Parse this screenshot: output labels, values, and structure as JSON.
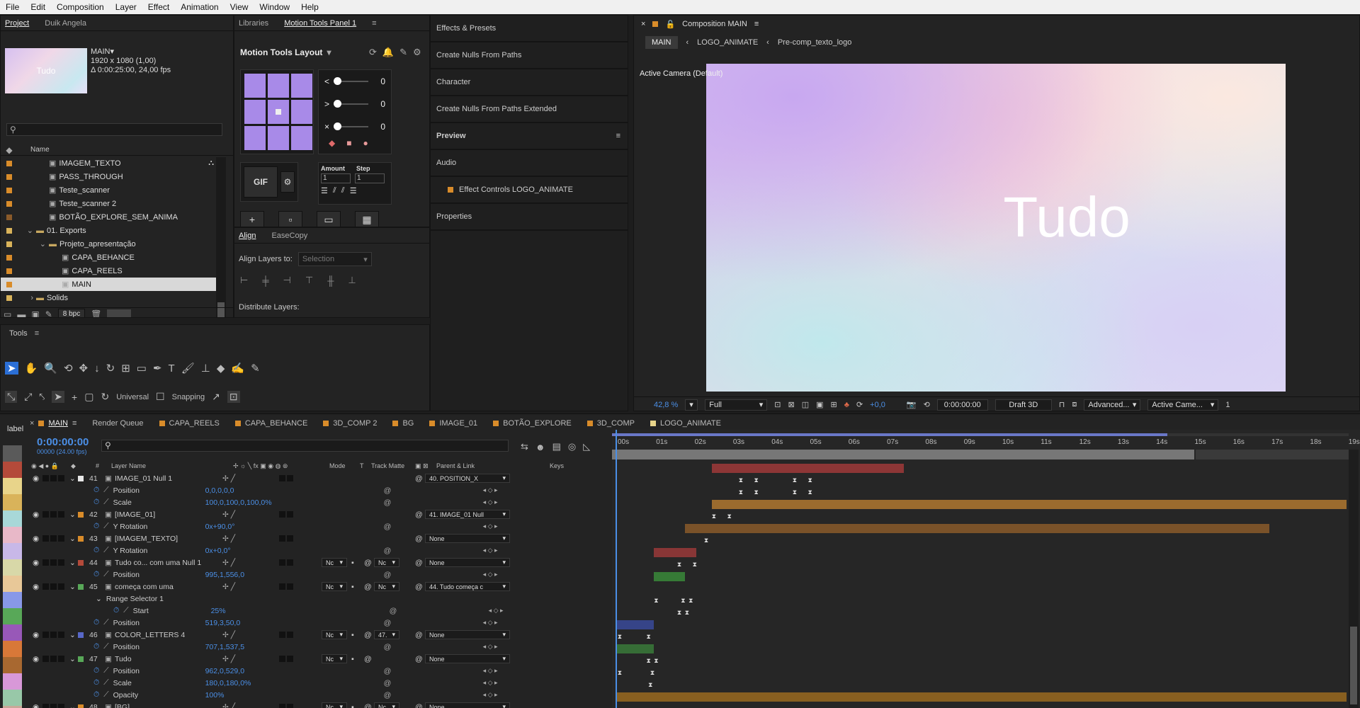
{
  "menu": [
    "File",
    "Edit",
    "Composition",
    "Layer",
    "Effect",
    "Animation",
    "View",
    "Window",
    "Help"
  ],
  "project": {
    "tabs": [
      "Project",
      "Duik Angela"
    ],
    "comp_name": "MAIN▾",
    "comp_info1": "1920 x 1080 (1,00)",
    "comp_info2": "Δ 0:00:25:00, 24,00 fps",
    "thumb_text": "Tudo",
    "search_placeholder": "",
    "col_name": "Name",
    "items": [
      {
        "name": "IMAGEM_TEXTO",
        "color": "#d98c2a",
        "indent": 1,
        "type": "comp"
      },
      {
        "name": "PASS_THROUGH",
        "color": "#d98c2a",
        "indent": 1,
        "type": "comp"
      },
      {
        "name": "Teste_scanner",
        "color": "#d98c2a",
        "indent": 1,
        "type": "comp"
      },
      {
        "name": "Teste_scanner 2",
        "color": "#d98c2a",
        "indent": 1,
        "type": "comp"
      },
      {
        "name": "BOTÃO_EXPLORE_SEM_ANIMA",
        "color": "#8a5a2a",
        "indent": 1,
        "type": "comp"
      },
      {
        "name": "01. Exports",
        "color": "#d9b35a",
        "indent": 0,
        "type": "folder",
        "open": true
      },
      {
        "name": "Projeto_apresentação",
        "color": "#d9b35a",
        "indent": 1,
        "type": "folder",
        "open": true
      },
      {
        "name": "CAPA_BEHANCE",
        "color": "#d98c2a",
        "indent": 2,
        "type": "comp"
      },
      {
        "name": "CAPA_REELS",
        "color": "#d98c2a",
        "indent": 2,
        "type": "comp"
      },
      {
        "name": "MAIN",
        "color": "#d98c2a",
        "indent": 2,
        "type": "comp",
        "selected": true
      },
      {
        "name": "Solids",
        "color": "#d9b35a",
        "indent": 0,
        "type": "folder",
        "open": false
      }
    ],
    "bpc": "8 bpc"
  },
  "motion_tools": {
    "tabs": [
      "Libraries",
      "Motion Tools Panel 1"
    ],
    "layout_title": "Motion Tools Layout",
    "sliders": [
      {
        "icon": "<",
        "value": "0"
      },
      {
        "icon": ">",
        "value": "0"
      },
      {
        "icon": "×",
        "value": "0"
      }
    ],
    "gif": "GIF",
    "amount_label": "Amount",
    "step_label": "Step",
    "amount": "1",
    "step": "1"
  },
  "align": {
    "tabs": [
      "Align",
      "EaseCopy"
    ],
    "align_to_label": "Align Layers to:",
    "align_to_value": "Selection",
    "distribute_label": "Distribute Layers:"
  },
  "effects": {
    "items": [
      "Effects & Presets",
      "Create Nulls From Paths",
      "Character",
      "Create Nulls From Paths Extended",
      "Preview",
      "Audio",
      "Effect Controls LOGO_ANIMATE",
      "Properties"
    ]
  },
  "tools": {
    "title": "Tools",
    "universal": "Universal",
    "snapping": "Snapping"
  },
  "composition": {
    "title": "Composition MAIN",
    "breadcrumbs": [
      "MAIN",
      "LOGO_ANIMATE",
      "Pre-comp_texto_logo"
    ],
    "camera_label": "Active Camera (Default)",
    "canvas_text": "Tudo",
    "zoom": "42,8 %",
    "resolution": "Full",
    "exposure": "+0,0",
    "timecode": "0:00:00:00",
    "renderer": "Draft 3D",
    "advanced": "Advanced...",
    "camera": "Active Came...",
    "views": "1"
  },
  "timeline": {
    "tabs": [
      {
        "name": "MAIN",
        "color": "#d98c2a",
        "active": true
      },
      {
        "name": "Render Queue",
        "color": ""
      },
      {
        "name": "CAPA_REELS",
        "color": "#d98c2a"
      },
      {
        "name": "CAPA_BEHANCE",
        "color": "#d98c2a"
      },
      {
        "name": "3D_COMP 2",
        "color": "#d98c2a"
      },
      {
        "name": "BG",
        "color": "#d98c2a"
      },
      {
        "name": "IMAGE_01",
        "color": "#d98c2a"
      },
      {
        "name": "BOTÃO_EXPLORE",
        "color": "#d98c2a"
      },
      {
        "name": "3D_COMP",
        "color": "#d98c2a"
      },
      {
        "name": "LOGO_ANIMATE",
        "color": "#e8d48a"
      }
    ],
    "timecode": "0:00:00:00",
    "timecode_sub": "00000 (24.00 fps)",
    "headers": {
      "layer_name": "Layer Name",
      "mode": "Mode",
      "t": "T",
      "track_matte": "Track Matte",
      "parent": "Parent & Link",
      "keys": "Keys",
      "label": "label"
    },
    "ruler": [
      "00s",
      "01s",
      "02s",
      "03s",
      "04s",
      "05s",
      "06s",
      "07s",
      "08s",
      "09s",
      "10s",
      "11s",
      "12s",
      "13s",
      "14s",
      "15s",
      "16s",
      "17s",
      "18s",
      "19s"
    ],
    "label_colors": [
      "#5a5a5a",
      "#b44a3a",
      "#e8d48a",
      "#d9b35a",
      "#a8d8d8",
      "#e8b8c8",
      "#c8b8e8",
      "#d8d8a8",
      "#e8c898",
      "#8898e8",
      "#58a858",
      "#9858b8",
      "#d87838",
      "#a86830",
      "#d898d8",
      "#98c8a8",
      "#c8a898",
      "#58a858"
    ],
    "rows": [
      {
        "num": "41",
        "name": "IMAGE_01 Null 1",
        "kind": "layer",
        "color": "#e8e8e8",
        "parent": "40. POSITION_X",
        "value": ""
      },
      {
        "num": "",
        "name": "Position",
        "kind": "prop",
        "value": "0,0,0,0,0"
      },
      {
        "num": "",
        "name": "Scale",
        "kind": "prop",
        "value": "100,0,100,0,100,0%"
      },
      {
        "num": "42",
        "name": "[IMAGE_01]",
        "kind": "layer",
        "color": "#d98c2a",
        "parent": "41. IMAGE_01 Null",
        "value": ""
      },
      {
        "num": "",
        "name": "Y Rotation",
        "kind": "prop",
        "value": "0x+90,0°"
      },
      {
        "num": "43",
        "name": "[IMAGEM_TEXTO]",
        "kind": "layer",
        "color": "#d98c2a",
        "parent": "None",
        "value": ""
      },
      {
        "num": "",
        "name": "Y Rotation",
        "kind": "prop",
        "value": "0x+0,0°"
      },
      {
        "num": "44",
        "name": "Tudo co... com uma Null 1",
        "kind": "layer",
        "color": "#b44a3a",
        "parent": "None",
        "mode": "Nc",
        "matte": "Nc",
        "value": ""
      },
      {
        "num": "",
        "name": "Position",
        "kind": "prop",
        "value": "995,1,556,0"
      },
      {
        "num": "45",
        "name": "começa com uma",
        "kind": "layer",
        "color": "#58a858",
        "parent": "44. Tudo começa c",
        "mode": "Nc",
        "matte": "Nc",
        "value": ""
      },
      {
        "num": "",
        "name": "Range Selector 1",
        "kind": "group",
        "value": ""
      },
      {
        "num": "",
        "name": "Start",
        "kind": "prop2",
        "value": "25%"
      },
      {
        "num": "",
        "name": "Position",
        "kind": "prop",
        "value": "519,3,50,0"
      },
      {
        "num": "46",
        "name": "COLOR_LETTERS 4",
        "kind": "layer",
        "color": "#5868c8",
        "parent": "None",
        "mode": "Nc",
        "matte": "47.",
        "value": ""
      },
      {
        "num": "",
        "name": "Position",
        "kind": "prop",
        "value": "707,1,537,5"
      },
      {
        "num": "47",
        "name": "Tudo",
        "kind": "layer",
        "color": "#58a858",
        "parent": "None",
        "mode": "Nc",
        "value": ""
      },
      {
        "num": "",
        "name": "Position",
        "kind": "prop",
        "value": "962,0,529,0"
      },
      {
        "num": "",
        "name": "Scale",
        "kind": "prop",
        "value": "180,0,180,0%"
      },
      {
        "num": "",
        "name": "Opacity",
        "kind": "prop",
        "value": "100%"
      },
      {
        "num": "48",
        "name": "[BG]",
        "kind": "layer",
        "color": "#d98c2a",
        "parent": "None",
        "mode": "Nc",
        "matte": "Nc",
        "value": ""
      }
    ]
  }
}
